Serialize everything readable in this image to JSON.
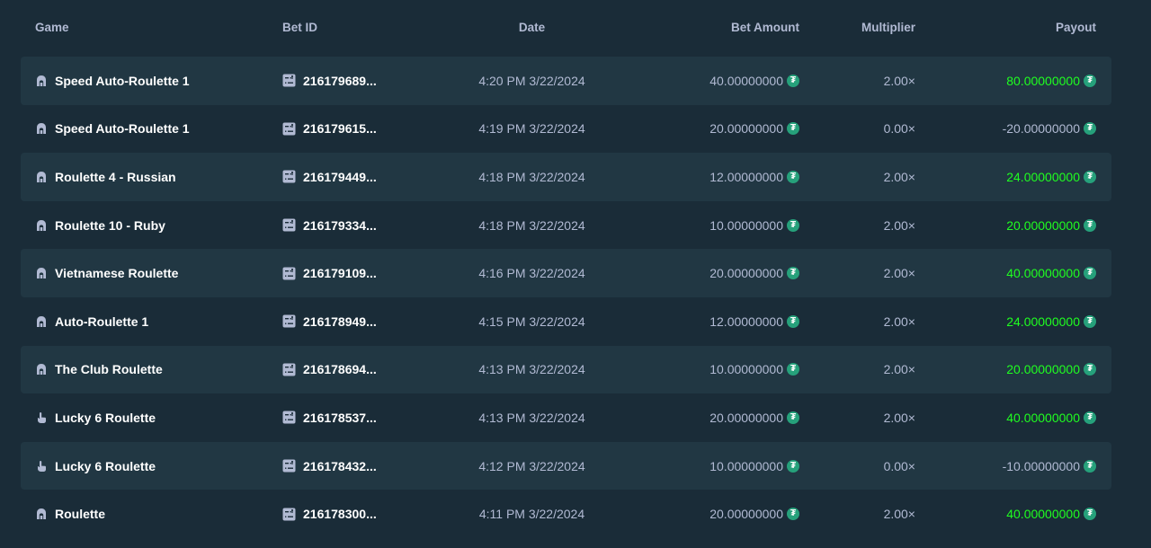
{
  "headers": {
    "game": "Game",
    "bet_id": "Bet ID",
    "date": "Date",
    "bet_amount": "Bet Amount",
    "multiplier": "Multiplier",
    "payout": "Payout"
  },
  "colors": {
    "background": "#1a2c38",
    "row_alt": "#213743",
    "text_muted": "#b1bad3",
    "win_green": "#1fff20",
    "coin": "#26a17b"
  },
  "currency_icon": "tether-coin-icon",
  "rows": [
    {
      "game": "Speed Auto-Roulette 1",
      "game_icon": "live-dealer-icon",
      "bet_id": "216179689...",
      "date": "4:20 PM 3/22/2024",
      "amount": "40.00000000",
      "multiplier": "2.00×",
      "payout": "80.00000000",
      "win": true
    },
    {
      "game": "Speed Auto-Roulette 1",
      "game_icon": "live-dealer-icon",
      "bet_id": "216179615...",
      "date": "4:19 PM 3/22/2024",
      "amount": "20.00000000",
      "multiplier": "0.00×",
      "payout": "-20.00000000",
      "win": false
    },
    {
      "game": "Roulette 4 - Russian",
      "game_icon": "live-dealer-icon",
      "bet_id": "216179449...",
      "date": "4:18 PM 3/22/2024",
      "amount": "12.00000000",
      "multiplier": "2.00×",
      "payout": "24.00000000",
      "win": true
    },
    {
      "game": "Roulette 10 - Ruby",
      "game_icon": "live-dealer-icon",
      "bet_id": "216179334...",
      "date": "4:18 PM 3/22/2024",
      "amount": "10.00000000",
      "multiplier": "2.00×",
      "payout": "20.00000000",
      "win": true
    },
    {
      "game": "Vietnamese Roulette",
      "game_icon": "live-dealer-icon",
      "bet_id": "216179109...",
      "date": "4:16 PM 3/22/2024",
      "amount": "20.00000000",
      "multiplier": "2.00×",
      "payout": "40.00000000",
      "win": true
    },
    {
      "game": "Auto-Roulette 1",
      "game_icon": "live-dealer-icon",
      "bet_id": "216178949...",
      "date": "4:15 PM 3/22/2024",
      "amount": "12.00000000",
      "multiplier": "2.00×",
      "payout": "24.00000000",
      "win": true
    },
    {
      "game": "The Club Roulette",
      "game_icon": "live-dealer-icon",
      "bet_id": "216178694...",
      "date": "4:13 PM 3/22/2024",
      "amount": "10.00000000",
      "multiplier": "2.00×",
      "payout": "20.00000000",
      "win": true
    },
    {
      "game": "Lucky 6 Roulette",
      "game_icon": "hand-pointer-icon",
      "bet_id": "216178537...",
      "date": "4:13 PM 3/22/2024",
      "amount": "20.00000000",
      "multiplier": "2.00×",
      "payout": "40.00000000",
      "win": true
    },
    {
      "game": "Lucky 6 Roulette",
      "game_icon": "hand-pointer-icon",
      "bet_id": "216178432...",
      "date": "4:12 PM 3/22/2024",
      "amount": "10.00000000",
      "multiplier": "0.00×",
      "payout": "-10.00000000",
      "win": false
    },
    {
      "game": "Roulette",
      "game_icon": "live-dealer-icon",
      "bet_id": "216178300...",
      "date": "4:11 PM 3/22/2024",
      "amount": "20.00000000",
      "multiplier": "2.00×",
      "payout": "40.00000000",
      "win": true
    }
  ]
}
